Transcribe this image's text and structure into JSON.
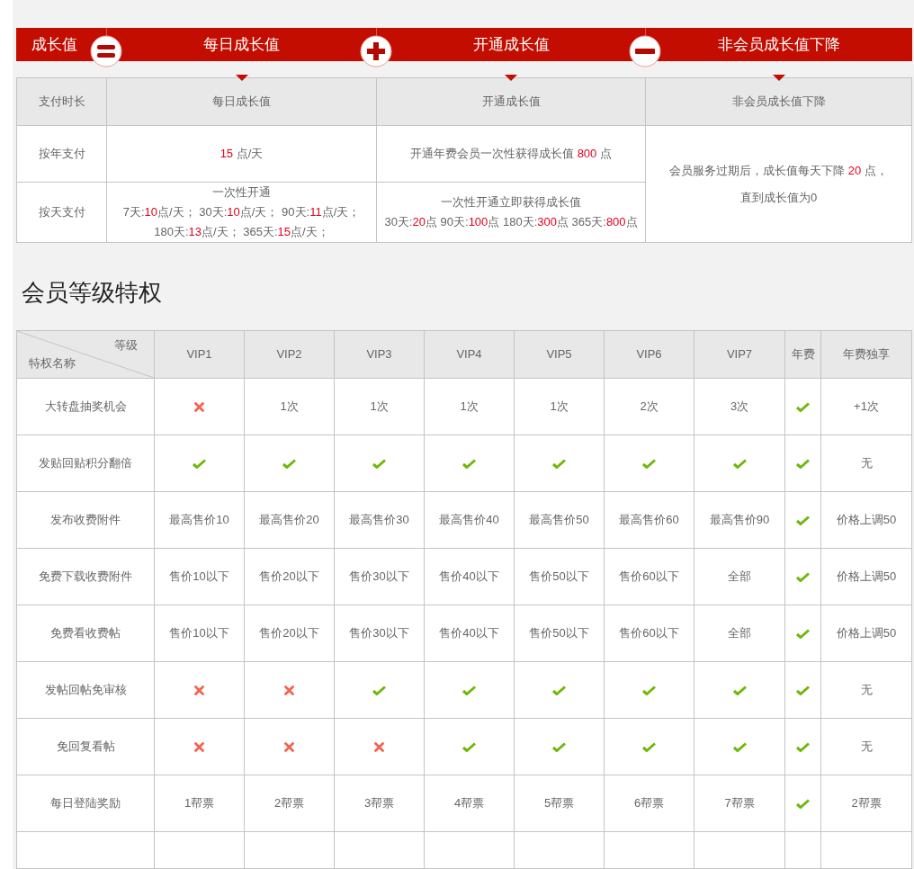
{
  "growth_banner": [
    {
      "label": "成长值",
      "kind": "equals",
      "pointer": false
    },
    {
      "label": "每日成长值",
      "kind": "plus",
      "pointer": true
    },
    {
      "label": "开通成长值",
      "kind": "minus",
      "pointer": true
    },
    {
      "label": "非会员成长值下降",
      "kind": "plain",
      "pointer": true
    }
  ],
  "growth_table": {
    "columns": [
      "支付时长",
      "每日成长值",
      "开通成长值",
      "非会员成长值下降"
    ],
    "rows": [
      {
        "label": "按年支付",
        "daily": [
          [
            {
              "text": "15",
              "red": true
            },
            {
              "text": " 点/天",
              "red": false
            }
          ]
        ],
        "opening": [
          [
            {
              "text": "开通年费会员一次性获得成长值 ",
              "red": false
            },
            {
              "text": "800",
              "red": true
            },
            {
              "text": " 点",
              "red": false
            }
          ]
        ]
      },
      {
        "label": "按天支付",
        "daily": [
          [
            {
              "text": "一次性开通",
              "red": false
            }
          ],
          [
            {
              "text": "7天:",
              "red": false
            },
            {
              "text": "10",
              "red": true
            },
            {
              "text": "点/天； 30天:",
              "red": false
            },
            {
              "text": "10",
              "red": true
            },
            {
              "text": "点/天； 90天:",
              "red": false
            },
            {
              "text": "11",
              "red": true
            },
            {
              "text": "点/天；",
              "red": false
            }
          ],
          [
            {
              "text": "180天:",
              "red": false
            },
            {
              "text": "13",
              "red": true
            },
            {
              "text": "点/天； 365天:",
              "red": false
            },
            {
              "text": "15",
              "red": true
            },
            {
              "text": "点/天；",
              "red": false
            }
          ]
        ],
        "opening": [
          [
            {
              "text": "一次性开通立即获得成长值",
              "red": false
            }
          ],
          [
            {
              "text": "30天:",
              "red": false
            },
            {
              "text": "20",
              "red": true
            },
            {
              "text": "点 90天:",
              "red": false
            },
            {
              "text": "100",
              "red": true
            },
            {
              "text": "点 180天:",
              "red": false
            },
            {
              "text": "300",
              "red": true
            },
            {
              "text": "点 365天:",
              "red": false
            },
            {
              "text": "800",
              "red": true
            },
            {
              "text": "点",
              "red": false
            }
          ]
        ]
      }
    ],
    "decline": [
      [
        {
          "text": "会员服务过期后，成长值每天下降 ",
          "red": false
        },
        {
          "text": "20",
          "red": true
        },
        {
          "text": " 点，",
          "red": false
        }
      ],
      [
        {
          "text": "直到成长值为0",
          "red": false
        }
      ]
    ]
  },
  "privileges_title": "会员等级特权",
  "privileges_table": {
    "corner": {
      "top": "等级",
      "bottom": "特权名称"
    },
    "columns": [
      "VIP1",
      "VIP2",
      "VIP3",
      "VIP4",
      "VIP5",
      "VIP6",
      "VIP7",
      "年费",
      "年费独享"
    ],
    "rows": [
      {
        "name": "大转盘抽奖机会",
        "cells": [
          {
            "kind": "cross"
          },
          {
            "kind": "text",
            "text": "1次"
          },
          {
            "kind": "text",
            "text": "1次"
          },
          {
            "kind": "text",
            "text": "1次"
          },
          {
            "kind": "text",
            "text": "1次"
          },
          {
            "kind": "text",
            "text": "2次"
          },
          {
            "kind": "text",
            "text": "3次"
          },
          {
            "kind": "check"
          },
          {
            "kind": "text",
            "text": "+1次"
          }
        ]
      },
      {
        "name": "发贴回贴积分翻倍",
        "cells": [
          {
            "kind": "check"
          },
          {
            "kind": "check"
          },
          {
            "kind": "check"
          },
          {
            "kind": "check"
          },
          {
            "kind": "check"
          },
          {
            "kind": "check"
          },
          {
            "kind": "check"
          },
          {
            "kind": "check"
          },
          {
            "kind": "text",
            "text": "无"
          }
        ]
      },
      {
        "name": "发布收费附件",
        "cells": [
          {
            "kind": "text",
            "text": "最高售价10"
          },
          {
            "kind": "text",
            "text": "最高售价20"
          },
          {
            "kind": "text",
            "text": "最高售价30"
          },
          {
            "kind": "text",
            "text": "最高售价40"
          },
          {
            "kind": "text",
            "text": "最高售价50"
          },
          {
            "kind": "text",
            "text": "最高售价60"
          },
          {
            "kind": "text",
            "text": "最高售价90"
          },
          {
            "kind": "check"
          },
          {
            "kind": "text",
            "text": "价格上调50"
          }
        ]
      },
      {
        "name": "免费下载收费附件",
        "cells": [
          {
            "kind": "text",
            "text": "售价10以下"
          },
          {
            "kind": "text",
            "text": "售价20以下"
          },
          {
            "kind": "text",
            "text": "售价30以下"
          },
          {
            "kind": "text",
            "text": "售价40以下"
          },
          {
            "kind": "text",
            "text": "售价50以下"
          },
          {
            "kind": "text",
            "text": "售价60以下"
          },
          {
            "kind": "text",
            "text": "全部"
          },
          {
            "kind": "check"
          },
          {
            "kind": "text",
            "text": "价格上调50"
          }
        ]
      },
      {
        "name": "免费看收费帖",
        "cells": [
          {
            "kind": "text",
            "text": "售价10以下"
          },
          {
            "kind": "text",
            "text": "售价20以下"
          },
          {
            "kind": "text",
            "text": "售价30以下"
          },
          {
            "kind": "text",
            "text": "售价40以下"
          },
          {
            "kind": "text",
            "text": "售价50以下"
          },
          {
            "kind": "text",
            "text": "售价60以下"
          },
          {
            "kind": "text",
            "text": "全部"
          },
          {
            "kind": "check"
          },
          {
            "kind": "text",
            "text": "价格上调50"
          }
        ]
      },
      {
        "name": "发帖回帖免审核",
        "cells": [
          {
            "kind": "cross"
          },
          {
            "kind": "cross"
          },
          {
            "kind": "check"
          },
          {
            "kind": "check"
          },
          {
            "kind": "check"
          },
          {
            "kind": "check"
          },
          {
            "kind": "check"
          },
          {
            "kind": "check"
          },
          {
            "kind": "text",
            "text": "无"
          }
        ]
      },
      {
        "name": "免回复看帖",
        "cells": [
          {
            "kind": "cross"
          },
          {
            "kind": "cross"
          },
          {
            "kind": "cross"
          },
          {
            "kind": "check"
          },
          {
            "kind": "check"
          },
          {
            "kind": "check"
          },
          {
            "kind": "check"
          },
          {
            "kind": "check"
          },
          {
            "kind": "text",
            "text": "无"
          }
        ]
      },
      {
        "name": "每日登陆奖励",
        "cells": [
          {
            "kind": "text",
            "text": "1帮票"
          },
          {
            "kind": "text",
            "text": "2帮票"
          },
          {
            "kind": "text",
            "text": "3帮票"
          },
          {
            "kind": "text",
            "text": "4帮票"
          },
          {
            "kind": "text",
            "text": "5帮票"
          },
          {
            "kind": "text",
            "text": "6帮票"
          },
          {
            "kind": "text",
            "text": "7帮票"
          },
          {
            "kind": "check"
          },
          {
            "kind": "text",
            "text": "2帮票"
          }
        ]
      }
    ]
  }
}
